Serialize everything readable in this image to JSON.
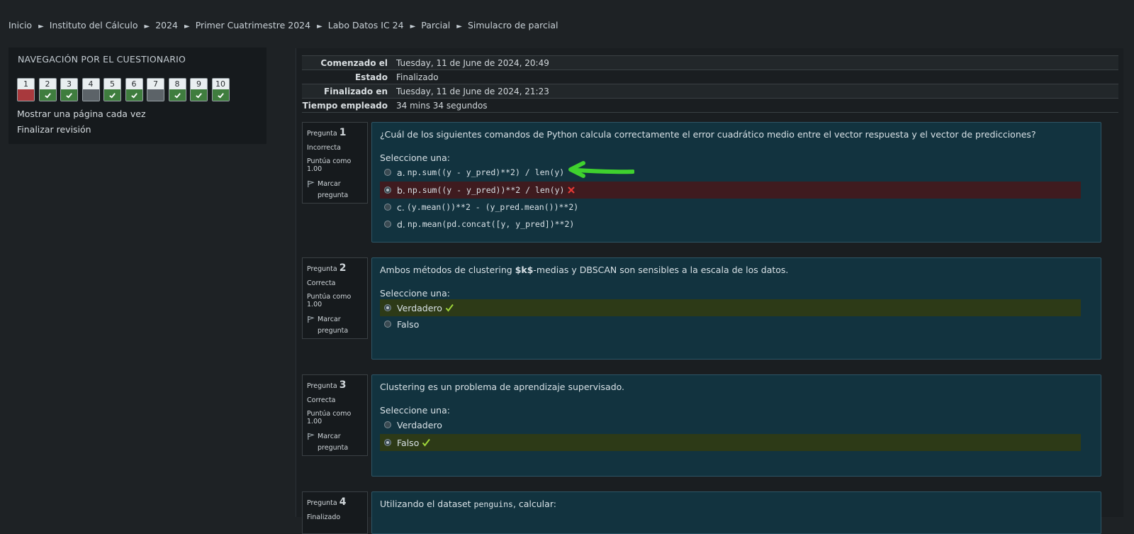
{
  "breadcrumb": [
    "Inicio",
    "Instituto del Cálculo",
    "2024",
    "Primer Cuatrimestre 2024",
    "Labo Datos IC 24",
    "Parcial",
    "Simulacro de parcial"
  ],
  "breadcrumb_separator": "►",
  "quiz_nav": {
    "title": "NAVEGACIÓN POR EL CUESTIONARIO",
    "questions": [
      {
        "num": "1",
        "state": "incorrect"
      },
      {
        "num": "2",
        "state": "correct"
      },
      {
        "num": "3",
        "state": "correct"
      },
      {
        "num": "4",
        "state": "complete"
      },
      {
        "num": "5",
        "state": "correct"
      },
      {
        "num": "6",
        "state": "correct"
      },
      {
        "num": "7",
        "state": "complete"
      },
      {
        "num": "8",
        "state": "correct"
      },
      {
        "num": "9",
        "state": "correct"
      },
      {
        "num": "10",
        "state": "correct"
      }
    ],
    "show_one_page": "Mostrar una página cada vez",
    "finish_review": "Finalizar revisión"
  },
  "summary": {
    "started_label": "Comenzado el",
    "started_value": "Tuesday, 11 de June de 2024, 20:49",
    "state_label": "Estado",
    "state_value": "Finalizado",
    "finished_label": "Finalizado en",
    "finished_value": "Tuesday, 11 de June de 2024, 21:23",
    "time_label": "Tiempo empleado",
    "time_value": "34 mins 34 segundos"
  },
  "common": {
    "pregunta": "Pregunta",
    "puntua": "Puntúa como 1.00",
    "flag": "Marcar pregunta",
    "prompt": "Seleccione una:"
  },
  "q1": {
    "number": "1",
    "status": "Incorrecta",
    "text": "¿Cuál de los siguientes comandos de Python calcula correctamente el error cuadrático medio entre el vector respuesta y el vector de predicciones?",
    "options": [
      {
        "letter": "a.",
        "code": "np.sum((y - y_pred)**2) / len(y)"
      },
      {
        "letter": "b.",
        "code": "np.sum((y - y_pred))**2 / len(y)"
      },
      {
        "letter": "c.",
        "code": "(y.mean())**2 - (y_pred.mean())**2)"
      },
      {
        "letter": "d.",
        "code": "np.mean(pd.concat([y, y_pred])**2)"
      }
    ]
  },
  "q2": {
    "number": "2",
    "status": "Correcta",
    "text_pre": "Ambos métodos de clustering ",
    "text_code": "$k$",
    "text_post": "-medias y DBSCAN son sensibles a la escala de los datos.",
    "options": [
      "Verdadero",
      "Falso"
    ]
  },
  "q3": {
    "number": "3",
    "status": "Correcta",
    "text": "Clustering es un problema de aprendizaje supervisado.",
    "options": [
      "Verdadero",
      "Falso"
    ]
  },
  "q4": {
    "number": "4",
    "status": "Finalizado",
    "text_pre": "Utilizando el dataset ",
    "text_code": "penguins",
    "text_post": ", calcular:"
  },
  "colors": {
    "background": "#1e2225",
    "question_bg": "#12333f",
    "incorrect": "#a8393d",
    "correct": "#3f7d3e",
    "wrong_answer_bg": "#3f1b1f",
    "right_answer_bg": "#2d3a17",
    "annotation_arrow": "#3fd12e"
  },
  "icons": [
    "check-icon",
    "cross-icon",
    "flag-icon",
    "arrow-annotation"
  ]
}
